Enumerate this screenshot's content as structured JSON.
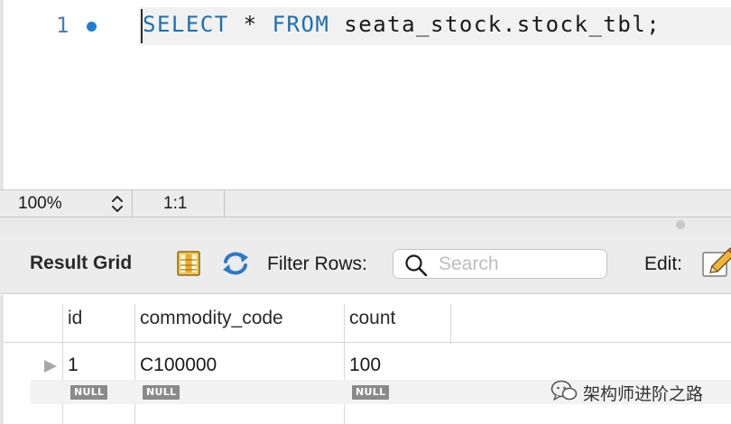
{
  "editor": {
    "line_number": "1",
    "code": {
      "select_kw": "SELECT",
      "star": " * ",
      "from_kw": "FROM",
      "rest": " seata_stock.stock_tbl;"
    }
  },
  "status": {
    "zoom": "100%",
    "cursor_position": "1:1"
  },
  "toolbar": {
    "title": "Result Grid",
    "filter_label": "Filter Rows:",
    "search_placeholder": "Search",
    "edit_label": "Edit:"
  },
  "grid": {
    "columns": [
      "id",
      "commodity_code",
      "count"
    ],
    "rows": [
      [
        "1",
        "C100000",
        "100"
      ]
    ],
    "new_row": [
      "NULL",
      "NULL",
      "NULL"
    ]
  },
  "watermark": {
    "text": "架构师进阶之路"
  },
  "colors": {
    "keyword": "#1a6fb3",
    "line_number": "#4a7fb5",
    "breakpoint": "#1e7ed6",
    "null_badge": "#8a8a8a"
  }
}
